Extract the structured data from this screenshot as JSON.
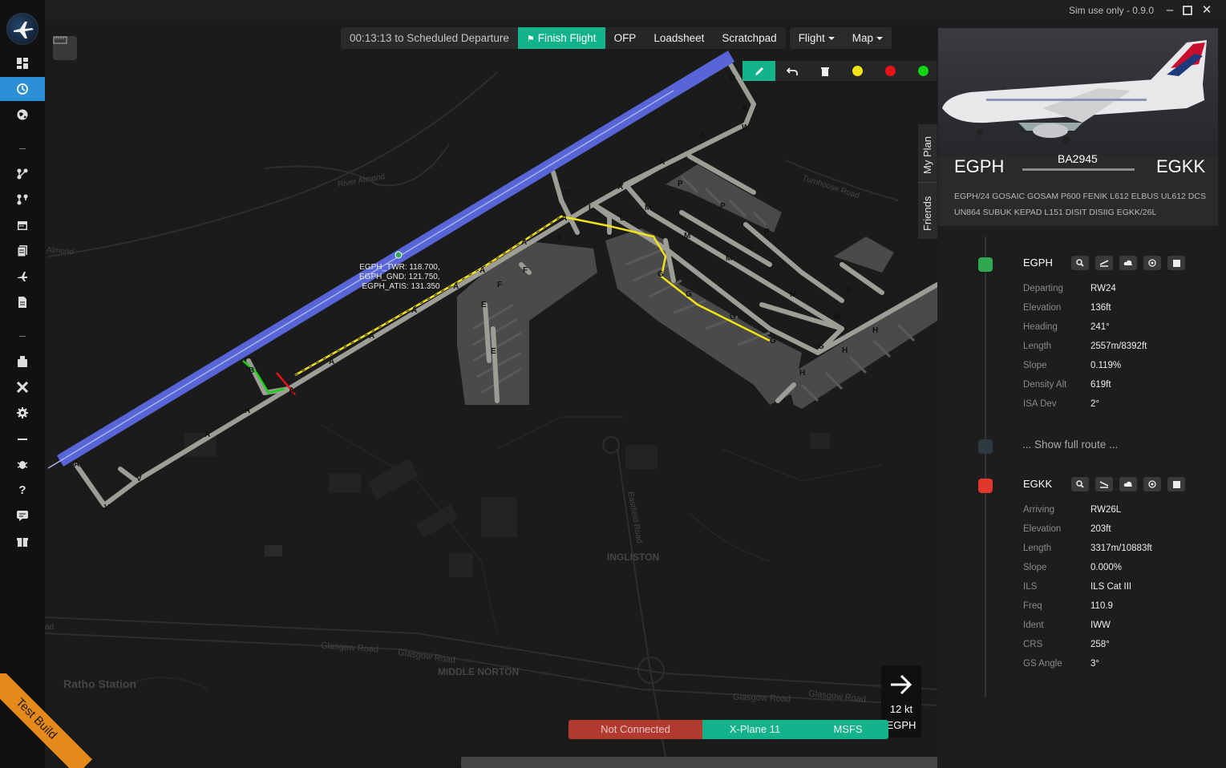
{
  "window": {
    "title": "Sim use only - 0.9.0",
    "controls": [
      "minimize-icon",
      "maximize-icon",
      "close-icon"
    ]
  },
  "sidebar": {
    "items": [
      {
        "name": "dashboard",
        "icon": "dashboard-icon"
      },
      {
        "name": "clock",
        "icon": "clock-icon",
        "active": true
      },
      {
        "name": "globe",
        "icon": "globe-icon"
      },
      {
        "name": "route-a",
        "icon": "route-icon"
      },
      {
        "name": "route-b",
        "icon": "route-icon"
      },
      {
        "name": "calendar",
        "icon": "calendar-icon"
      },
      {
        "name": "clipboard",
        "icon": "clipboard-icon"
      },
      {
        "name": "plane",
        "icon": "plane-icon"
      },
      {
        "name": "document",
        "icon": "document-icon"
      },
      {
        "name": "fuel",
        "icon": "fuel-icon"
      },
      {
        "name": "tools",
        "icon": "tools-icon"
      },
      {
        "name": "settings",
        "icon": "gear-icon"
      },
      {
        "name": "bug",
        "icon": "bug-icon"
      },
      {
        "name": "help",
        "icon": "question-icon"
      },
      {
        "name": "chat",
        "icon": "chat-icon"
      },
      {
        "name": "gift",
        "icon": "gift-icon"
      }
    ],
    "badge": "Test Build"
  },
  "toolbar": {
    "departure": "00:13:13 to Scheduled Departure",
    "finish": "Finish Flight",
    "ofp": "OFP",
    "loadsheet": "Loadsheet",
    "scratchpad": "Scratchpad",
    "flight": "Flight",
    "map": "Map"
  },
  "draw_tools": {
    "colors": [
      "#f2e21a",
      "#e8141a",
      "#12d411"
    ]
  },
  "tabs": {
    "my_plan": "My Plan",
    "friends": "Friends"
  },
  "map": {
    "frequencies": [
      "EGPH_TWR: 118.700,",
      "EGPH_GND: 121.750,",
      "EGPH_ATIS: 131.350"
    ],
    "places": {
      "ingliston": "INGLISTON",
      "middle_norton": "MIDDLE NORTON",
      "ratho_station": "Ratho Station",
      "glasgow_road": "Glasgow Road",
      "glasgow_road2": "Glasgow Road",
      "glasgow_road3": "Glasgow Road",
      "glasgow_road4": "Glasgow Road",
      "turnhouse_road": "Turnhouse Road",
      "river_almond": "River Almond",
      "almond": "Almond",
      "eastfield_road": "Eastfield Road",
      "rd": "ad"
    },
    "taxi_labels": [
      "D",
      "A",
      "W",
      "A",
      "A",
      "C",
      "L",
      "A",
      "P",
      "L",
      "M",
      "P",
      "P",
      "M",
      "M",
      "C",
      "G",
      "M",
      "S",
      "M",
      "G",
      "G",
      "G",
      "H",
      "H",
      "H",
      "A",
      "A",
      "A",
      "F",
      "F",
      "F",
      "E",
      "E",
      "A",
      "A",
      "B",
      "A",
      "A",
      "A",
      "V",
      "V",
      "A"
    ],
    "route_color": "#f2e21a",
    "runway_color": "#5765d6"
  },
  "speed": {
    "value": "12 kt",
    "airport": "EGPH"
  },
  "connection": {
    "status": "Not Connected",
    "sim1": "X-Plane 11",
    "sim2": "MSFS"
  },
  "flight": {
    "origin": "EGPH",
    "destination": "EGKK",
    "number": "BA2945",
    "route": "EGPH/24 GOSAIC GOSAM P600 FENIK L612 ELBUS UL612 DCS UN864 SUBUK KEPAD L151 DISIT DISIIG EGKK/26L"
  },
  "departure": {
    "icao": "EGPH",
    "color": "#2fa84f",
    "rows": [
      {
        "k": "Departing",
        "v": "RW24"
      },
      {
        "k": "Elevation",
        "v": "136ft"
      },
      {
        "k": "Heading",
        "v": "241°"
      },
      {
        "k": "Length",
        "v": "2557m/8392ft"
      },
      {
        "k": "Slope",
        "v": "0.119%"
      },
      {
        "k": "Density Alt",
        "v": "619ft"
      },
      {
        "k": "ISA Dev",
        "v": "2°"
      }
    ]
  },
  "show_route": "... Show full route ...",
  "arrival": {
    "icao": "EGKK",
    "color": "#e0392b",
    "rows": [
      {
        "k": "Arriving",
        "v": "RW26L"
      },
      {
        "k": "Elevation",
        "v": "203ft"
      },
      {
        "k": "Length",
        "v": "3317m/10883ft"
      },
      {
        "k": "Slope",
        "v": "0.000%"
      },
      {
        "k": "ILS",
        "v": "ILS Cat III"
      },
      {
        "k": "Freq",
        "v": "110.9"
      },
      {
        "k": "Ident",
        "v": "IWW"
      },
      {
        "k": "CRS",
        "v": "258°"
      },
      {
        "k": "GS Angle",
        "v": "3°"
      }
    ]
  }
}
